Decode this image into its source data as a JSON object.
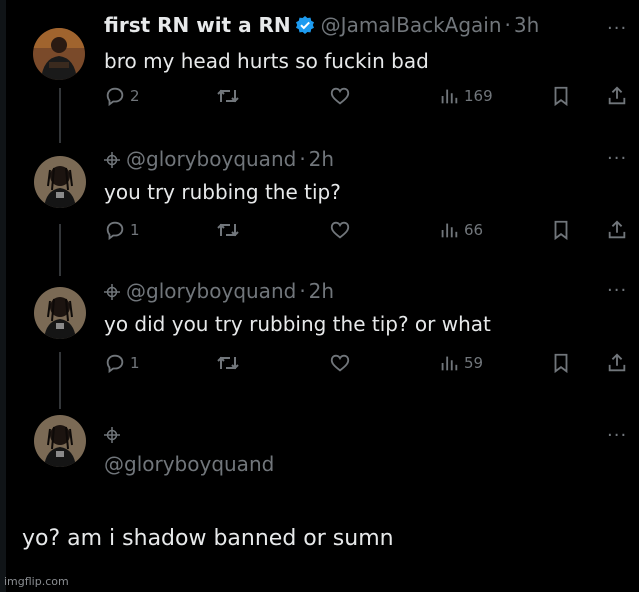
{
  "tweets": [
    {
      "name": "first RN wit a RN",
      "handle": "@JamalBackAgain",
      "sep": "·",
      "time": "3h",
      "text": "bro my head hurts so fuckin bad",
      "replies": "2",
      "views": "169",
      "verified": true
    },
    {
      "handle": "@gloryboyquand",
      "sep": "·",
      "time": "2h",
      "text": "you try rubbing the tip?",
      "replies": "1",
      "views": "66"
    },
    {
      "handle": "@gloryboyquand",
      "sep": "·",
      "time": "2h",
      "text": "yo did you try rubbing the tip? or what",
      "replies": "1",
      "views": "59"
    },
    {
      "handle": "@gloryboyquand"
    }
  ],
  "more_glyph": "···",
  "final_text": "yo? am i shadow banned or sumn",
  "watermark": "imgflip.com",
  "colors": {
    "background": "#000000",
    "text": "#e7e9ea",
    "muted": "#71767b",
    "verified": "#1d9bf0"
  }
}
